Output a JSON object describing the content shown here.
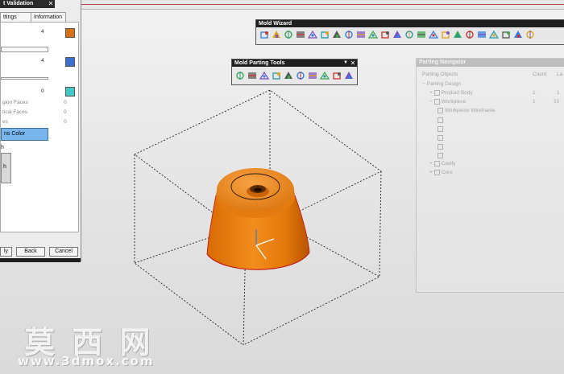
{
  "validation_panel": {
    "title": "t Validation",
    "tabs": [
      "ttings",
      "Information"
    ],
    "rows": [
      {
        "value": "4",
        "color": "#d77116"
      },
      {
        "value": "4",
        "color": "#3c6fd0"
      },
      {
        "value": "0",
        "color": "#43c7c7"
      }
    ],
    "faces": [
      {
        "label": "gion Faces",
        "value": "0"
      },
      {
        "label": "tical Faces",
        "value": "0"
      },
      {
        "label": "es",
        "value": "0"
      }
    ],
    "color_button": "ns Color",
    "group_label": "h",
    "group_item": "h",
    "buttons": [
      "ly",
      "Back",
      "Cancel"
    ]
  },
  "mold_wizard": {
    "title": "Mold Wizard",
    "icons": [
      "project-init-icon",
      "family-mold-icon",
      "csys-icon",
      "shrinkage-icon",
      "workpiece-icon",
      "layout-icon",
      "tooling-icon",
      "parting-icon",
      "moldbase-icon",
      "standard-part-icon",
      "ejector-icon",
      "slider-lifter-icon",
      "sub-insert-icon",
      "gate-icon",
      "runner-icon",
      "cooling-icon",
      "electrode-icon",
      "trim-icon",
      "pocket-icon",
      "bom-icon",
      "drawing-icon",
      "view-manager-icon",
      "unused-part-icon"
    ]
  },
  "parting_tools": {
    "title": "Mold Parting Tools",
    "icons": [
      "region-analysis-icon",
      "curve-surface-icon",
      "patch-icon",
      "split-face-icon",
      "define-region-icon",
      "design-parting-surface-icon",
      "edit-patch-icon",
      "define-cavity-core-icon",
      "swap-model-icon",
      "backup-parting-icon"
    ]
  },
  "parting_navigator": {
    "title": "Parting Navigator",
    "columns": [
      "Parting Objects",
      "Count",
      "La"
    ],
    "items": [
      {
        "label": "Parting Design",
        "count": "",
        "layer": ""
      },
      {
        "label": "Product Body",
        "count": "1",
        "layer": "1"
      },
      {
        "label": "Workpiece",
        "count": "1",
        "layer": "10"
      },
      {
        "label": "Workpiece Wireframe",
        "count": "",
        "layer": ""
      },
      {
        "label": "Cavity",
        "count": "",
        "layer": ""
      },
      {
        "label": "Core",
        "count": "",
        "layer": ""
      }
    ]
  },
  "watermark": {
    "chinese": "莫 西 网",
    "url": "www.3dmox.com"
  },
  "colors": {
    "part_orange": "#e07a10",
    "part_highlight": "#f5a13a",
    "edge_red": "#c01010",
    "toolbar_title_bg": "#1f1f1f"
  }
}
